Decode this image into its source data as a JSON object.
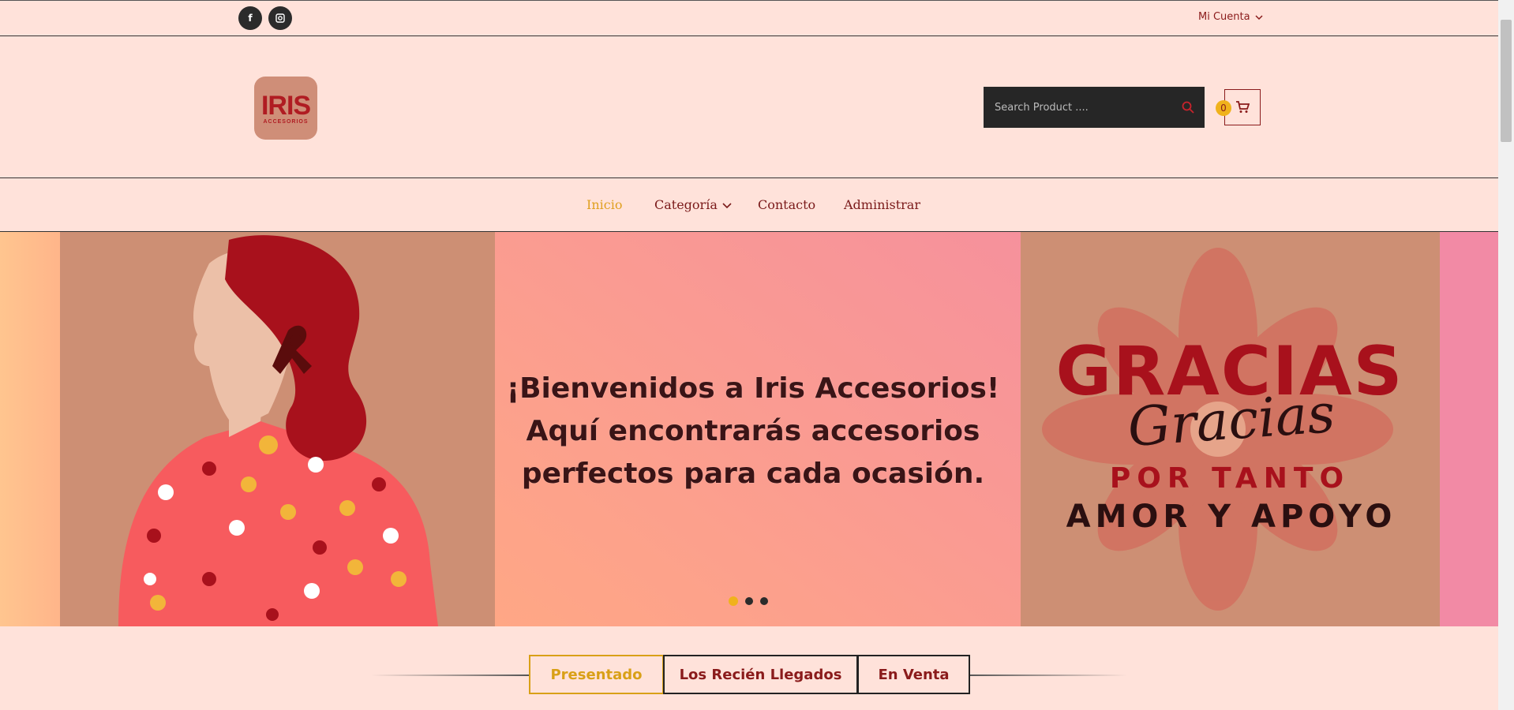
{
  "topbar": {
    "social": [
      {
        "label": "f",
        "icon": "facebook-icon"
      },
      {
        "label": "▣",
        "icon": "instagram-icon"
      }
    ],
    "account_label": "Mi Cuenta"
  },
  "header": {
    "logo_main": "IRIS",
    "logo_sub": "ACCESORIOS",
    "search_placeholder": "Search Product ....",
    "cart_count": "0"
  },
  "nav": {
    "items": [
      "Inicio",
      "Categoría",
      "Contacto",
      "Administrar"
    ],
    "active": "Inicio"
  },
  "hero": {
    "welcome_line1": "¡Bienvenidos a Iris Accesorios!",
    "welcome_line2": "Aquí encontrarás accesorios",
    "welcome_line3": "perfectos para cada ocasión.",
    "thanks_title": "GRACIAS",
    "thanks_script": "Gracias",
    "thanks_line1": "POR TANTO",
    "thanks_line2": "AMOR Y APOYO",
    "slider_dots": 3,
    "active_dot": 0
  },
  "tabs": [
    "Presentado",
    "Los Recién Llegados",
    "En Venta"
  ],
  "colors": {
    "page_bg": "#ffe2da",
    "brand_red": "#8a1b1b",
    "accent_gold": "#d9a017",
    "dark": "#262626"
  }
}
